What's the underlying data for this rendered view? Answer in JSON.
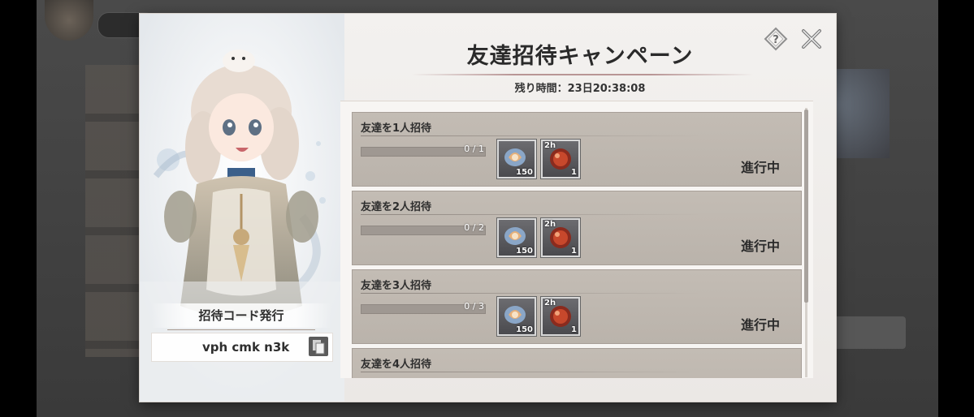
{
  "modal": {
    "title": "友達招待キャンペーン",
    "timer_label": "残り時間：23日20:38:08"
  },
  "invite": {
    "section_title": "招待コード発行",
    "code": "vph cmk n3k"
  },
  "missions": [
    {
      "title": "友達を1人招待",
      "progress_text": "0 / 1",
      "progress": 0,
      "rewards": [
        {
          "icon": "gem-icon",
          "quantity": "150",
          "tag": ""
        },
        {
          "icon": "red-orb-icon",
          "quantity": "1",
          "tag": "2h"
        }
      ],
      "status": "進行中"
    },
    {
      "title": "友達を2人招待",
      "progress_text": "0 / 2",
      "progress": 0,
      "rewards": [
        {
          "icon": "gem-icon",
          "quantity": "150",
          "tag": ""
        },
        {
          "icon": "red-orb-icon",
          "quantity": "1",
          "tag": "2h"
        }
      ],
      "status": "進行中"
    },
    {
      "title": "友達を3人招待",
      "progress_text": "0 / 3",
      "progress": 0,
      "rewards": [
        {
          "icon": "gem-icon",
          "quantity": "150",
          "tag": ""
        },
        {
          "icon": "red-orb-icon",
          "quantity": "1",
          "tag": "2h"
        }
      ],
      "status": "進行中"
    },
    {
      "title": "友達を4人招待",
      "progress_text": "",
      "progress": 0,
      "rewards": [],
      "status": ""
    }
  ],
  "colors": {
    "panel_bg": "#ebe8e5",
    "mission_bg": "#bfb8b0",
    "title_rule": "#b89595"
  }
}
